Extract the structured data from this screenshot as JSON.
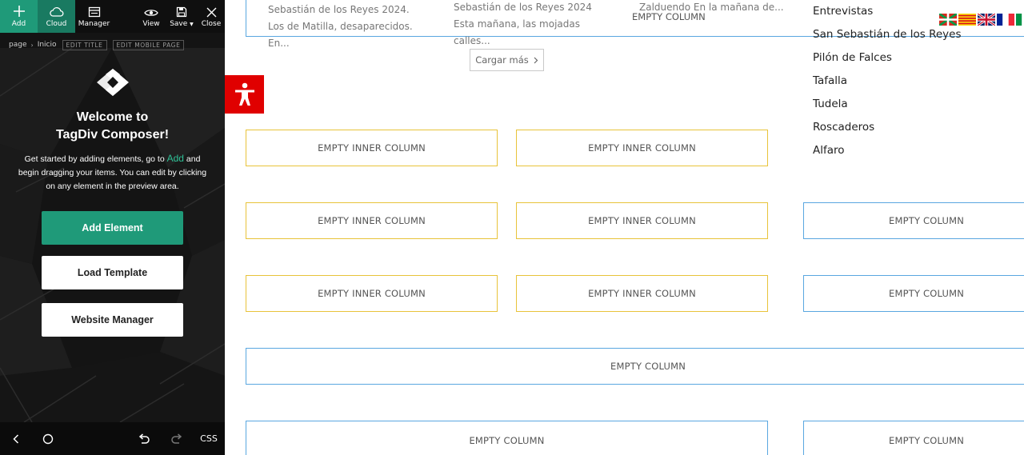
{
  "toolbar": {
    "add_label": "Add",
    "cloud_label": "Cloud",
    "manager_label": "Manager",
    "view_label": "View",
    "save_label": "Save",
    "close_label": "Close"
  },
  "breadcrumb": {
    "page": "page",
    "current": "Inicio",
    "edit_title": "EDIT TITLE",
    "edit_mobile": "EDIT MOBILE PAGE"
  },
  "welcome": {
    "line1": "Welcome to",
    "line2": "TagDiv Composer!",
    "intro_before": "Get started by adding elements, go to ",
    "intro_accent": "Add",
    "intro_after": " and begin dragging your items. You can edit by clicking on any element in the preview area."
  },
  "buttons": {
    "add_element": "Add Element",
    "load_template": "Load Template",
    "website_manager": "Website Manager"
  },
  "bottombar": {
    "css_label": "CSS"
  },
  "preview": {
    "news": [
      "Sebastián de los Reyes 2024. Los de Matilla, desaparecidos. En...",
      "Sebastián de los Reyes 2024 Esta mañana, las mojadas calles...",
      "Zalduendo En la mañana de..."
    ],
    "top_empty": "EMPTY COLUMN",
    "load_more": "Cargar más",
    "empty_inner": "EMPTY INNER COLUMN",
    "empty_column": "EMPTY COLUMN",
    "menu": [
      "Entrevistas",
      "San Sebastián de los Reyes",
      "Pilón de Falces",
      "Tafalla",
      "Tudela",
      "Roscaderos",
      "Alfaro"
    ]
  },
  "colors": {
    "accent": "#1f9a79",
    "accent_light": "#2ec096",
    "column_border": "#5aa7e0",
    "inner_border": "#e8c33a",
    "accessibility": "#e00000"
  },
  "icons": [
    "plus-icon",
    "cloud-icon",
    "manager-icon",
    "eye-icon",
    "save-icon",
    "close-icon",
    "tagdiv-logo",
    "accessibility-icon",
    "chevron-right-icon",
    "back-icon",
    "home-icon",
    "undo-icon",
    "redo-icon"
  ]
}
